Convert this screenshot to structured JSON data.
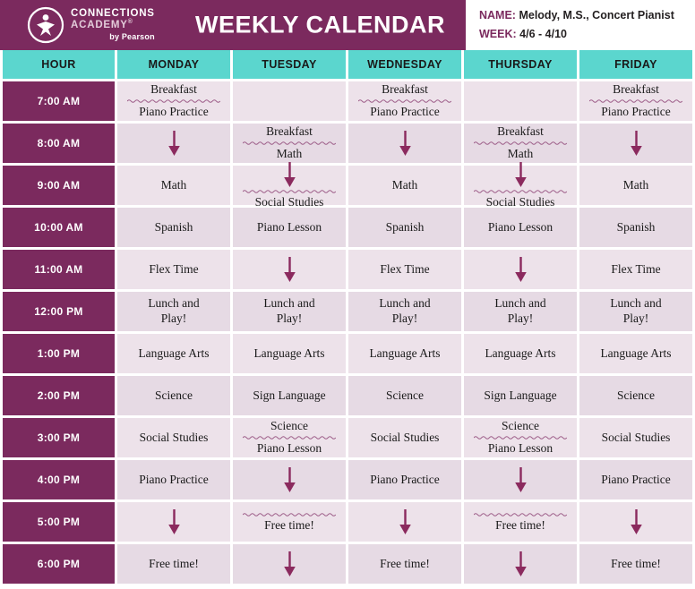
{
  "brand": {
    "line1": "CONNECTIONS",
    "line2": "ACADEMY",
    "registered": "®",
    "line3": "by Pearson",
    "logo_icon": "person-in-circle-logo-icon"
  },
  "header": {
    "title": "WEEKLY CALENDAR",
    "name_label": "NAME:",
    "name_value": "Melody, M.S., Concert Pianist",
    "week_label": "WEEK:",
    "week_value": "4/6 - 4/10"
  },
  "colors": {
    "brand_purple": "#7B2A5E",
    "teal_header": "#5BD6CE",
    "cell_light": "#EDE2EA",
    "cell_dark": "#E6DAE4",
    "arrow": "#8B2A5E",
    "squiggle": "#9B5A86"
  },
  "columns": [
    "HOUR",
    "MONDAY",
    "TUESDAY",
    "WEDNESDAY",
    "THURSDAY",
    "FRIDAY"
  ],
  "rows": [
    {
      "hour": "7:00 AM",
      "cells": [
        {
          "type": "text",
          "lines": [
            "Breakfast",
            "Piano Practice"
          ],
          "squiggle_after": 0
        },
        {
          "type": "empty"
        },
        {
          "type": "text",
          "lines": [
            "Breakfast",
            "Piano Practice"
          ],
          "squiggle_after": 0
        },
        {
          "type": "empty"
        },
        {
          "type": "text",
          "lines": [
            "Breakfast",
            "Piano Practice"
          ],
          "squiggle_after": 0
        }
      ]
    },
    {
      "hour": "8:00 AM",
      "cells": [
        {
          "type": "arrow"
        },
        {
          "type": "text",
          "lines": [
            "Breakfast",
            "Math"
          ],
          "squiggle_after": 0
        },
        {
          "type": "arrow"
        },
        {
          "type": "text",
          "lines": [
            "Breakfast",
            "Math"
          ],
          "squiggle_after": 0
        },
        {
          "type": "arrow"
        }
      ]
    },
    {
      "hour": "9:00 AM",
      "cells": [
        {
          "type": "text",
          "lines": [
            "Math"
          ]
        },
        {
          "type": "arrow-text",
          "lines": [
            "Social Studies"
          ],
          "squiggle_after": 0
        },
        {
          "type": "text",
          "lines": [
            "Math"
          ]
        },
        {
          "type": "arrow-text",
          "lines": [
            "Social Studies"
          ],
          "squiggle_after": 0
        },
        {
          "type": "text",
          "lines": [
            "Math"
          ]
        }
      ]
    },
    {
      "hour": "10:00 AM",
      "cells": [
        {
          "type": "text",
          "lines": [
            "Spanish"
          ]
        },
        {
          "type": "text",
          "lines": [
            "Piano Lesson"
          ]
        },
        {
          "type": "text",
          "lines": [
            "Spanish"
          ]
        },
        {
          "type": "text",
          "lines": [
            "Piano Lesson"
          ]
        },
        {
          "type": "text",
          "lines": [
            "Spanish"
          ]
        }
      ]
    },
    {
      "hour": "11:00 AM",
      "cells": [
        {
          "type": "text",
          "lines": [
            "Flex Time"
          ]
        },
        {
          "type": "arrow"
        },
        {
          "type": "text",
          "lines": [
            "Flex Time"
          ]
        },
        {
          "type": "arrow"
        },
        {
          "type": "text",
          "lines": [
            "Flex Time"
          ]
        }
      ]
    },
    {
      "hour": "12:00 PM",
      "cells": [
        {
          "type": "text",
          "lines": [
            "Lunch and",
            "Play!"
          ]
        },
        {
          "type": "text",
          "lines": [
            "Lunch and",
            "Play!"
          ]
        },
        {
          "type": "text",
          "lines": [
            "Lunch and",
            "Play!"
          ]
        },
        {
          "type": "text",
          "lines": [
            "Lunch and",
            "Play!"
          ]
        },
        {
          "type": "text",
          "lines": [
            "Lunch and",
            "Play!"
          ]
        }
      ]
    },
    {
      "hour": "1:00 PM",
      "cells": [
        {
          "type": "text",
          "lines": [
            "Language Arts"
          ]
        },
        {
          "type": "text",
          "lines": [
            "Language Arts"
          ]
        },
        {
          "type": "text",
          "lines": [
            "Language Arts"
          ]
        },
        {
          "type": "text",
          "lines": [
            "Language Arts"
          ]
        },
        {
          "type": "text",
          "lines": [
            "Language Arts"
          ]
        }
      ]
    },
    {
      "hour": "2:00 PM",
      "cells": [
        {
          "type": "text",
          "lines": [
            "Science"
          ]
        },
        {
          "type": "text",
          "lines": [
            "Sign Language"
          ]
        },
        {
          "type": "text",
          "lines": [
            "Science"
          ]
        },
        {
          "type": "text",
          "lines": [
            "Sign Language"
          ]
        },
        {
          "type": "text",
          "lines": [
            "Science"
          ]
        }
      ]
    },
    {
      "hour": "3:00 PM",
      "cells": [
        {
          "type": "text",
          "lines": [
            "Social Studies"
          ]
        },
        {
          "type": "text",
          "lines": [
            "Science",
            "Piano Lesson"
          ],
          "squiggle_after": 0
        },
        {
          "type": "text",
          "lines": [
            "Social Studies"
          ]
        },
        {
          "type": "text",
          "lines": [
            "Science",
            "Piano Lesson"
          ],
          "squiggle_after": 0
        },
        {
          "type": "text",
          "lines": [
            "Social Studies"
          ]
        }
      ]
    },
    {
      "hour": "4:00 PM",
      "cells": [
        {
          "type": "text",
          "lines": [
            "Piano Practice"
          ]
        },
        {
          "type": "arrow"
        },
        {
          "type": "text",
          "lines": [
            "Piano Practice"
          ]
        },
        {
          "type": "arrow"
        },
        {
          "type": "text",
          "lines": [
            "Piano Practice"
          ]
        }
      ]
    },
    {
      "hour": "5:00 PM",
      "cells": [
        {
          "type": "arrow"
        },
        {
          "type": "text",
          "lines": [
            "Free time!"
          ],
          "squiggle_before": true
        },
        {
          "type": "arrow"
        },
        {
          "type": "text",
          "lines": [
            "Free time!"
          ],
          "squiggle_before": true
        },
        {
          "type": "arrow"
        }
      ]
    },
    {
      "hour": "6:00 PM",
      "cells": [
        {
          "type": "text",
          "lines": [
            "Free time!"
          ]
        },
        {
          "type": "arrow"
        },
        {
          "type": "text",
          "lines": [
            "Free time!"
          ]
        },
        {
          "type": "arrow"
        },
        {
          "type": "text",
          "lines": [
            "Free time!"
          ]
        }
      ]
    }
  ]
}
